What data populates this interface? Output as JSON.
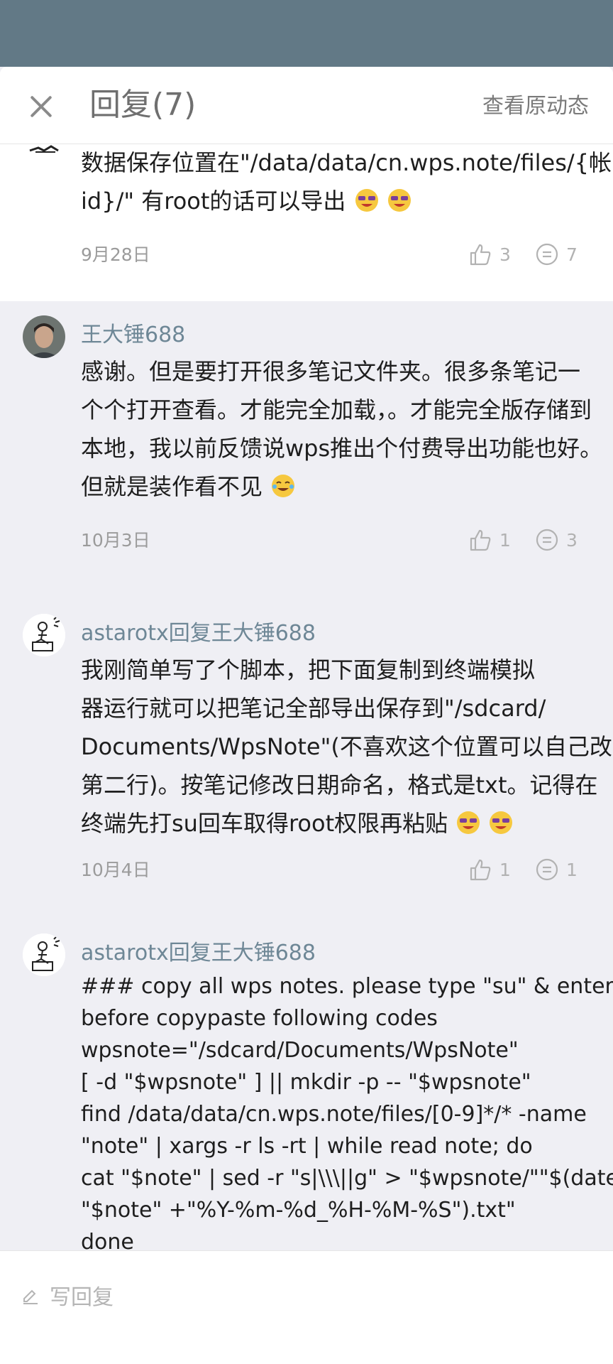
{
  "header": {
    "title": "回复(7)",
    "view_original": "查看原动态"
  },
  "comments": [
    {
      "author": "",
      "lines": [
        "数据保存位置在\"/data/data/cn.wps.note/files/{帐号",
        "id}/\" 有root的话可以导出"
      ],
      "date": "9月28日",
      "likes": "3",
      "replies": "7"
    },
    {
      "author": "王大锤688",
      "lines": [
        "感谢。但是要打开很多笔记文件夹。很多条笔记一",
        "个个打开查看。才能完全加载，。才能完全版存储到",
        "本地，我以前反馈说wps推出个付费导出功能也好。",
        "但就是装作看不见"
      ],
      "date": "10月3日",
      "likes": "1",
      "replies": "3"
    },
    {
      "author": "astarotx回复王大锤688",
      "lines": [
        "我刚简单写了个脚本，把下面复制到终端模拟",
        "器运行就可以把笔记全部导出保存到\"/sdcard/",
        "Documents/WpsNote\"(不喜欢这个位置可以自己改",
        "第二行)。按笔记修改日期命名，格式是txt。记得在",
        "终端先打su回车取得root权限再粘贴"
      ],
      "date": "10月4日",
      "likes": "1",
      "replies": "1"
    },
    {
      "author": "astarotx回复王大锤688",
      "lines": [
        "### copy all wps notes. please type \"su\" & enter",
        "before copypaste following codes",
        "wpsnote=\"/sdcard/Documents/WpsNote\"",
        "[ -d \"$wpsnote\" ] || mkdir -p -- \"$wpsnote\"",
        "find /data/data/cn.wps.note/files/[0-9]*/* -name",
        "\"note\" | xargs -r ls -rt | while read note; do",
        "cat \"$note\" | sed -r \"s|\\\\\\||g\" > \"$wpsnote/\"\"$(date -r",
        "\"$note\" +\"%Y-%m-%d_%H-%M-%S\").txt\"",
        "done"
      ]
    }
  ],
  "footer": {
    "reply_placeholder": "写回复"
  },
  "colors": {
    "status_bar": "#627986",
    "author": "#6e8796",
    "background_alt": "#efeff4"
  },
  "icons": [
    "close-icon",
    "thumbs-up-icon",
    "comment-icon",
    "pencil-icon",
    "laughing-emoji-icon",
    "tears-of-joy-emoji-icon",
    "avatar-photo",
    "avatar-drawing"
  ]
}
